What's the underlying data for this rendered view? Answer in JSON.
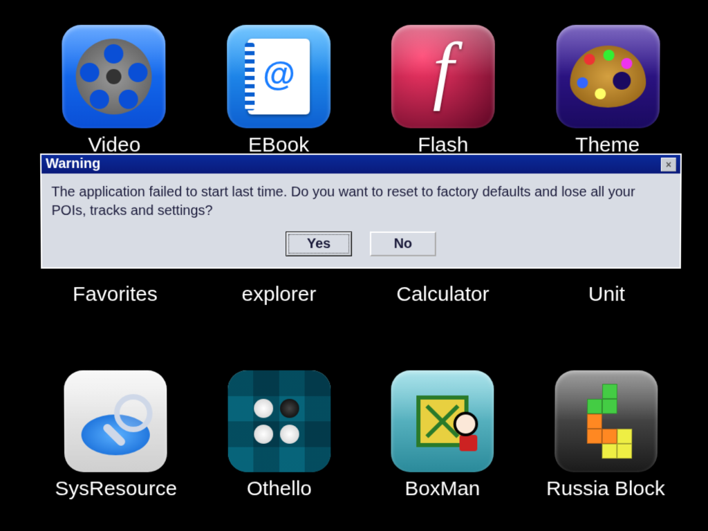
{
  "apps": {
    "row1": [
      {
        "id": "video",
        "label": "Video"
      },
      {
        "id": "ebook",
        "label": "EBook"
      },
      {
        "id": "flash",
        "label": "Flash"
      },
      {
        "id": "theme",
        "label": "Theme"
      }
    ],
    "row2": [
      {
        "id": "favorites",
        "label": "Favorites"
      },
      {
        "id": "explorer",
        "label": "explorer"
      },
      {
        "id": "calculator",
        "label": "Calculator"
      },
      {
        "id": "unit",
        "label": "Unit"
      }
    ],
    "row3": [
      {
        "id": "sysresource",
        "label": "SysResource"
      },
      {
        "id": "othello",
        "label": "Othello"
      },
      {
        "id": "boxman",
        "label": "BoxMan"
      },
      {
        "id": "russiablock",
        "label": "Russia Block"
      }
    ]
  },
  "dialog": {
    "title": "Warning",
    "message": "The application failed to start last time. Do you want to reset to factory defaults and lose all your POIs, tracks and settings?",
    "close": "×",
    "yes": "Yes",
    "no": "No"
  }
}
